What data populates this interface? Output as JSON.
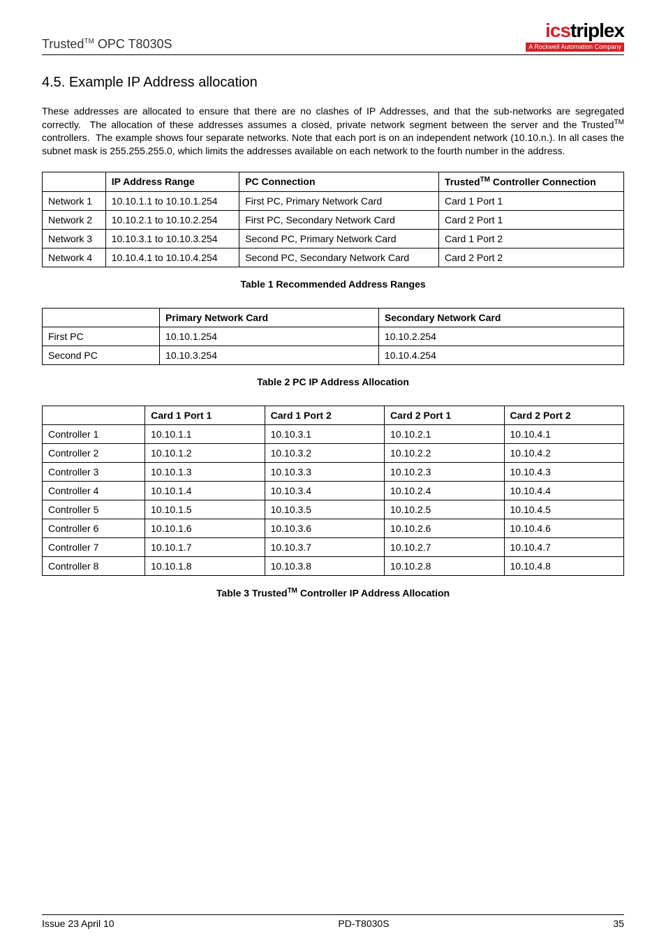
{
  "header": {
    "product": "Trusted",
    "tm": "TM",
    "suffix": " OPC T8030S",
    "logo_main_1": "ics",
    "logo_main_2": "triplex",
    "logo_sub": "A Rockwell Automation Company"
  },
  "section": {
    "number": "4.5.",
    "title": "Example IP Address allocation"
  },
  "paragraph": "These addresses are allocated to ensure that there are no clashes of IP Addresses, and that the sub-networks are segregated correctly.  The allocation of these addresses assumes a closed, private network segment between the server and the TrustedTM controllers.  The example shows four separate networks. Note that each port is on an independent network (10.10.n.). In all cases the subnet mask is 255.255.255.0, which limits the addresses available on each network to the fourth number in the address.",
  "table1": {
    "headers": [
      "",
      "IP Address Range",
      "PC Connection",
      "Trusted™ Controller Connection"
    ],
    "rows": [
      [
        "Network 1",
        "10.10.1.1 to 10.10.1.254",
        "First PC, Primary Network Card",
        "Card 1 Port 1"
      ],
      [
        "Network 2",
        "10.10.2.1 to 10.10.2.254",
        "First PC, Secondary Network Card",
        "Card 2 Port 1"
      ],
      [
        "Network 3",
        "10.10.3.1 to 10.10.3.254",
        "Second PC, Primary Network Card",
        "Card 1 Port 2"
      ],
      [
        "Network 4",
        "10.10.4.1 to 10.10.4.254",
        "Second PC, Secondary Network Card",
        "Card 2 Port 2"
      ]
    ],
    "caption": "Table 1 Recommended Address Ranges"
  },
  "table2": {
    "headers": [
      "",
      "Primary Network Card",
      "Secondary Network Card"
    ],
    "rows": [
      [
        "First PC",
        "10.10.1.254",
        "10.10.2.254"
      ],
      [
        "Second PC",
        "10.10.3.254",
        "10.10.4.254"
      ]
    ],
    "caption": "Table 2 PC IP Address Allocation"
  },
  "table3": {
    "headers": [
      "",
      "Card 1 Port 1",
      "Card 1 Port 2",
      "Card 2 Port 1",
      "Card 2 Port 2"
    ],
    "rows": [
      [
        "Controller 1",
        "10.10.1.1",
        "10.10.3.1",
        "10.10.2.1",
        "10.10.4.1"
      ],
      [
        "Controller 2",
        "10.10.1.2",
        "10.10.3.2",
        "10.10.2.2",
        "10.10.4.2"
      ],
      [
        "Controller 3",
        "10.10.1.3",
        "10.10.3.3",
        "10.10.2.3",
        "10.10.4.3"
      ],
      [
        "Controller 4",
        "10.10.1.4",
        "10.10.3.4",
        "10.10.2.4",
        "10.10.4.4"
      ],
      [
        "Controller 5",
        "10.10.1.5",
        "10.10.3.5",
        "10.10.2.5",
        "10.10.4.5"
      ],
      [
        "Controller 6",
        "10.10.1.6",
        "10.10.3.6",
        "10.10.2.6",
        "10.10.4.6"
      ],
      [
        "Controller 7",
        "10.10.1.7",
        "10.10.3.7",
        "10.10.2.7",
        "10.10.4.7"
      ],
      [
        "Controller 8",
        "10.10.1.8",
        "10.10.3.8",
        "10.10.2.8",
        "10.10.4.8"
      ]
    ],
    "caption": "Table 3 TrustedTM Controller IP Address Allocation"
  },
  "footer": {
    "left": "Issue 23 April 10",
    "center": "PD-T8030S",
    "right": "35"
  }
}
